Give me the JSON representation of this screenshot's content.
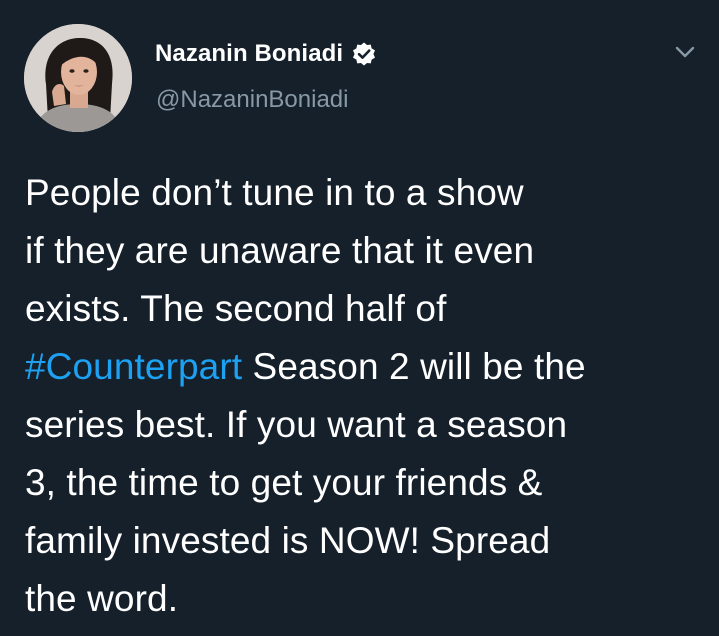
{
  "author": {
    "display_name": "Nazanin Boniadi",
    "handle": "@NazaninBoniadi",
    "verified": true
  },
  "tweet": {
    "lines": [
      "People don’t tune in to a show",
      "if they are unaware that it even",
      "exists. The second half of",
      {
        "hashtag": "#Counterpart",
        "rest": " Season 2 will be the"
      },
      "series best. If you want a season",
      "3, the time to get your friends &",
      "family invested is NOW! Spread",
      "the word."
    ]
  },
  "icons": {
    "verified": "verified-badge-icon",
    "menu": "chevron-down-icon",
    "avatar": "profile-photo"
  },
  "colors": {
    "background": "#15202b",
    "text": "#ffffff",
    "secondary_text": "#8899a6",
    "link": "#1da1f2"
  }
}
